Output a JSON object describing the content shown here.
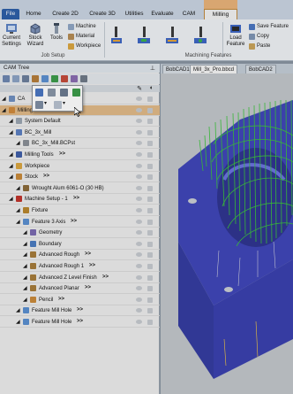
{
  "ribbon": {
    "tabs": [
      "File",
      "Home",
      "Create 2D",
      "Create 3D",
      "Utilities",
      "Evaluate",
      "CAM",
      "Milling"
    ],
    "active_tab": "Milling",
    "groups": {
      "job_setup": "Job Setup",
      "machining_features": "Machining Features"
    },
    "buttons": {
      "current_settings": "Current Settings",
      "stock_wizard": "Stock Wizard",
      "tools": "Tools",
      "machine": "Machine",
      "material": "Material",
      "workpiece": "Workpiece",
      "load_feature": "Load Feature",
      "save_feature": "Save Feature",
      "copy": "Copy",
      "paste": "Paste"
    }
  },
  "panel": {
    "title": "CAM Tree"
  },
  "doc_tabs": [
    "BobCAD1",
    "Mill_3x_Pro.bbcd",
    "BobCAD2"
  ],
  "active_doc_tab": "Mill_3x_Pro.bbcd",
  "tree": [
    {
      "label": "CA",
      "level": 0,
      "icon_color": "#6f8fbf"
    },
    {
      "label": "Milling Job",
      "level": 0,
      "icon_color": "#d08a3c",
      "selected": true
    },
    {
      "label": "System Default",
      "level": 1,
      "icon_color": "#9aa4b0"
    },
    {
      "label": "BC_3x_Mill",
      "level": 1,
      "icon_color": "#5b7fc0"
    },
    {
      "label": "BC_3x_Mill.BCPst",
      "level": 2,
      "icon_color": "#8a8f96"
    },
    {
      "label": "Milling Tools",
      "level": 1,
      "icon_color": "#3f5fa8",
      "arrows": ">>"
    },
    {
      "label": "Workpiece",
      "level": 1,
      "icon_color": "#d9a641"
    },
    {
      "label": "Stock",
      "level": 1,
      "icon_color": "#c88a3a",
      "arrows": ">>"
    },
    {
      "label": "Wrought Alum 6061-O (30 HB)",
      "level": 2,
      "icon_color": "#8b6a3a"
    },
    {
      "label": "Machine Setup - 1",
      "level": 1,
      "icon_color": "#c0342b",
      "arrows": ">>"
    },
    {
      "label": "Fixture",
      "level": 2,
      "icon_color": "#b8862e"
    },
    {
      "label": "Feature 3 Axis",
      "level": 2,
      "icon_color": "#5a8fd0",
      "arrows": ">>"
    },
    {
      "label": "Geometry",
      "level": 3,
      "icon_color": "#7b6ab0"
    },
    {
      "label": "Boundary",
      "level": 3,
      "icon_color": "#4a7cc0"
    },
    {
      "label": "Advanced Rough",
      "level": 3,
      "icon_color": "#a67c3a",
      "arrows": ">>"
    },
    {
      "label": "Advanced Rough 1",
      "level": 3,
      "icon_color": "#a67c3a",
      "arrows": ">>"
    },
    {
      "label": "Advanced Z Level Finish",
      "level": 3,
      "icon_color": "#a67c3a",
      "arrows": ">>"
    },
    {
      "label": "Advanced Planar",
      "level": 3,
      "icon_color": "#a67c3a",
      "arrows": ">>"
    },
    {
      "label": "Pencil",
      "level": 3,
      "icon_color": "#c98a3a",
      "arrows": ">>"
    },
    {
      "label": "Feature Mill Hole",
      "level": 2,
      "icon_color": "#5a8fd0",
      "arrows": ">>"
    },
    {
      "label": "Feature Mill Hole",
      "level": 2,
      "icon_color": "#5a8fd0",
      "arrows": ">>"
    }
  ],
  "colors": {
    "ribbon_bg": "#eef1f4",
    "selected_row": "#e0b987",
    "part_face": "#4b52c8",
    "toolpath": "#3cc43c"
  }
}
